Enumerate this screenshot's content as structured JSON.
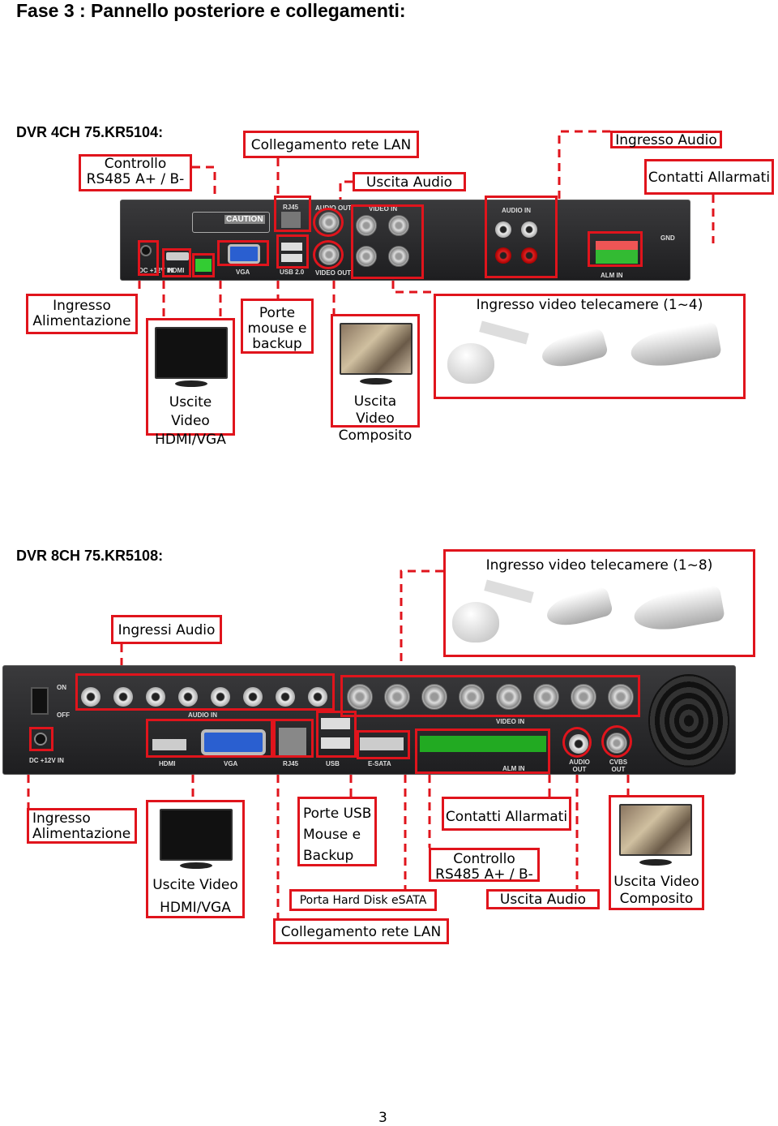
{
  "title": "Fase 3 : Pannello posteriore e collegamenti:",
  "dvr4": {
    "heading": "DVR 4CH 75.KR5104:",
    "labels": {
      "rs485": "Controllo RS485 A+ / B-",
      "lan": "Collegamento rete LAN",
      "audio_out": "Uscita Audio",
      "audio_in": "Ingresso Audio",
      "alarm": "Contatti Allarmati",
      "power": "Ingresso Alimentazione",
      "mouse": "Porte mouse e backup",
      "hdmi_vga": "Uscite Video HDMI/VGA",
      "composite": "Uscita Video Composito",
      "cameras": "Ingresso video telecamere  (1~4)"
    },
    "panel": {
      "caution": "CAUTION",
      "hdmi": "HDMI",
      "vga": "VGA",
      "usb": "USB 2.0",
      "rj45": "RJ45",
      "audio_out": "AUDIO OUT",
      "video_out": "VIDEO OUT",
      "video_in": "VIDEO IN",
      "audio_in": "AUDIO IN",
      "dc": "DC +12V IN",
      "gnd": "GND",
      "alarm": "ALM IN"
    }
  },
  "dvr8": {
    "heading": "DVR 8CH 75.KR5108:",
    "labels": {
      "cameras": "Ingresso video telecamere  (1~8)",
      "audio_in": "Ingressi Audio",
      "power": "Ingresso Alimentazione",
      "hdmi_vga": "Uscite Video HDMI/VGA",
      "usb": "Porte USB Mouse e Backup",
      "alarm": "Contatti Allarmati",
      "rs485": "Controllo RS485 A+ / B-",
      "esata": "Porta Hard Disk eSATA",
      "audio_out": "Uscita Audio",
      "composite": "Uscita Video Composito",
      "lan": "Collegamento rete LAN"
    },
    "panel": {
      "on": "ON",
      "off": "OFF",
      "audio_in": "AUDIO IN",
      "video_in": "VIDEO IN",
      "hdmi": "HDMI",
      "vga": "VGA",
      "rj45": "RJ45",
      "usb": "USB",
      "esata": "E-SATA",
      "audio_out": "AUDIO OUT",
      "cvbs_out": "CVBS OUT",
      "dc": "DC +12V IN",
      "alarm": "ALM IN"
    }
  },
  "page_number": "3",
  "colors": {
    "accent": "#e0141c",
    "panel": "#2a2a2c"
  }
}
